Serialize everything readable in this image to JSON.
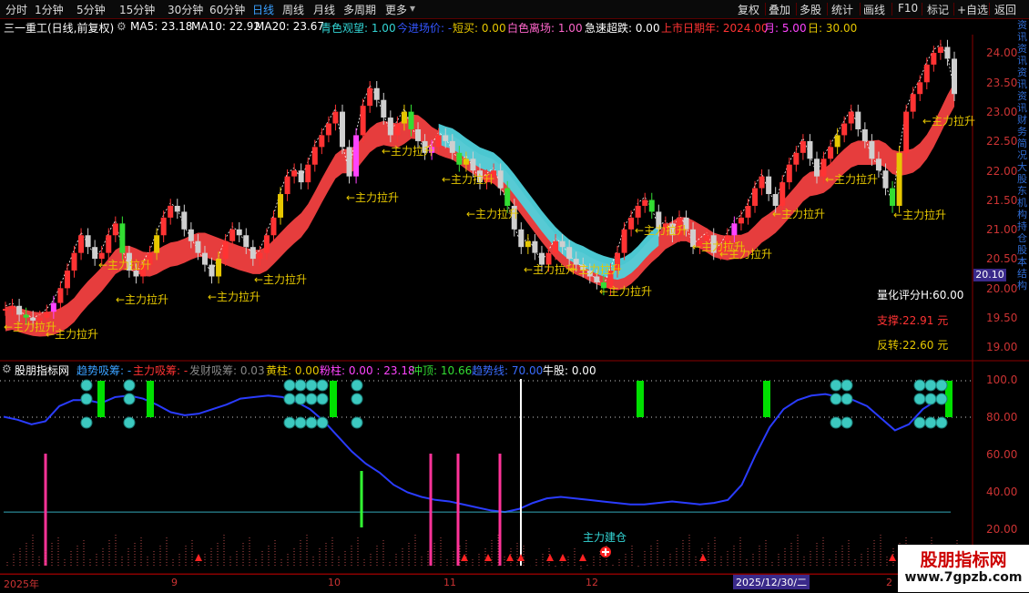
{
  "toolbar": {
    "periods": [
      "分时",
      "1分钟",
      "5分钟",
      "15分钟",
      "30分钟",
      "60分钟",
      "日线",
      "周线",
      "月线",
      "多周期",
      "更多"
    ],
    "active_period": "日线",
    "right_buttons": [
      "复权",
      "叠加",
      "多股",
      "统计",
      "画线",
      "F10",
      "标记",
      "+自选",
      "返回"
    ]
  },
  "info": {
    "title": "三一重工(日线,前复权)",
    "ma5": "MA5: 23.18",
    "ma10": "MA10: 22.92",
    "ma20": "MA20: 23.67",
    "qingse": "青色观望: 1.00",
    "jinchang": "今进场价: -",
    "duanmai": "短买: 0.00",
    "baise": "白色离场: 1.00",
    "jisu": "急速超跌: 0.00",
    "shangshi": "上市日期年: 2024.00",
    "yue": "月: 5.00",
    "ri": "日: 30.00"
  },
  "price_axis": [
    "24.00",
    "23.50",
    "23.00",
    "22.50",
    "22.00",
    "21.50",
    "21.00",
    "20.50",
    "20.00",
    "19.50",
    "19.00"
  ],
  "price_tag": "20.10",
  "score": {
    "label": "量化评分H:60.00",
    "support": "支撑:22.91 元",
    "reverse": "反转:22.60 元"
  },
  "annotation_text": "←主力拉升",
  "indicator": {
    "name": "股朋指标网",
    "qushi": "趋势吸筹: -",
    "zhuli": "主力吸筹: -",
    "fashe": "发财吸筹: 0.03",
    "huangzhu": "黄柱: 0.00",
    "fenzhu": "粉柱: 0.00 : 23.18",
    "chongding": "冲顶: 10.66",
    "qushixian": "趋势线: 70.00",
    "niugu": "牛股: 0.00",
    "axis": [
      "100.0",
      "80.00",
      "60.00",
      "40.00",
      "20.00"
    ],
    "label_jiancang": "主力建仓"
  },
  "date_axis": [
    "2025年",
    "9",
    "10",
    "11",
    "12",
    "2"
  ],
  "selected_date": "2025/12/30/二",
  "watermark": {
    "line1": "股朋指标网",
    "line2": "www.7gpzb.com"
  },
  "right_side_text": "资讯资讯资讯资讯财务简况大股东机构持仓股本结构"
}
